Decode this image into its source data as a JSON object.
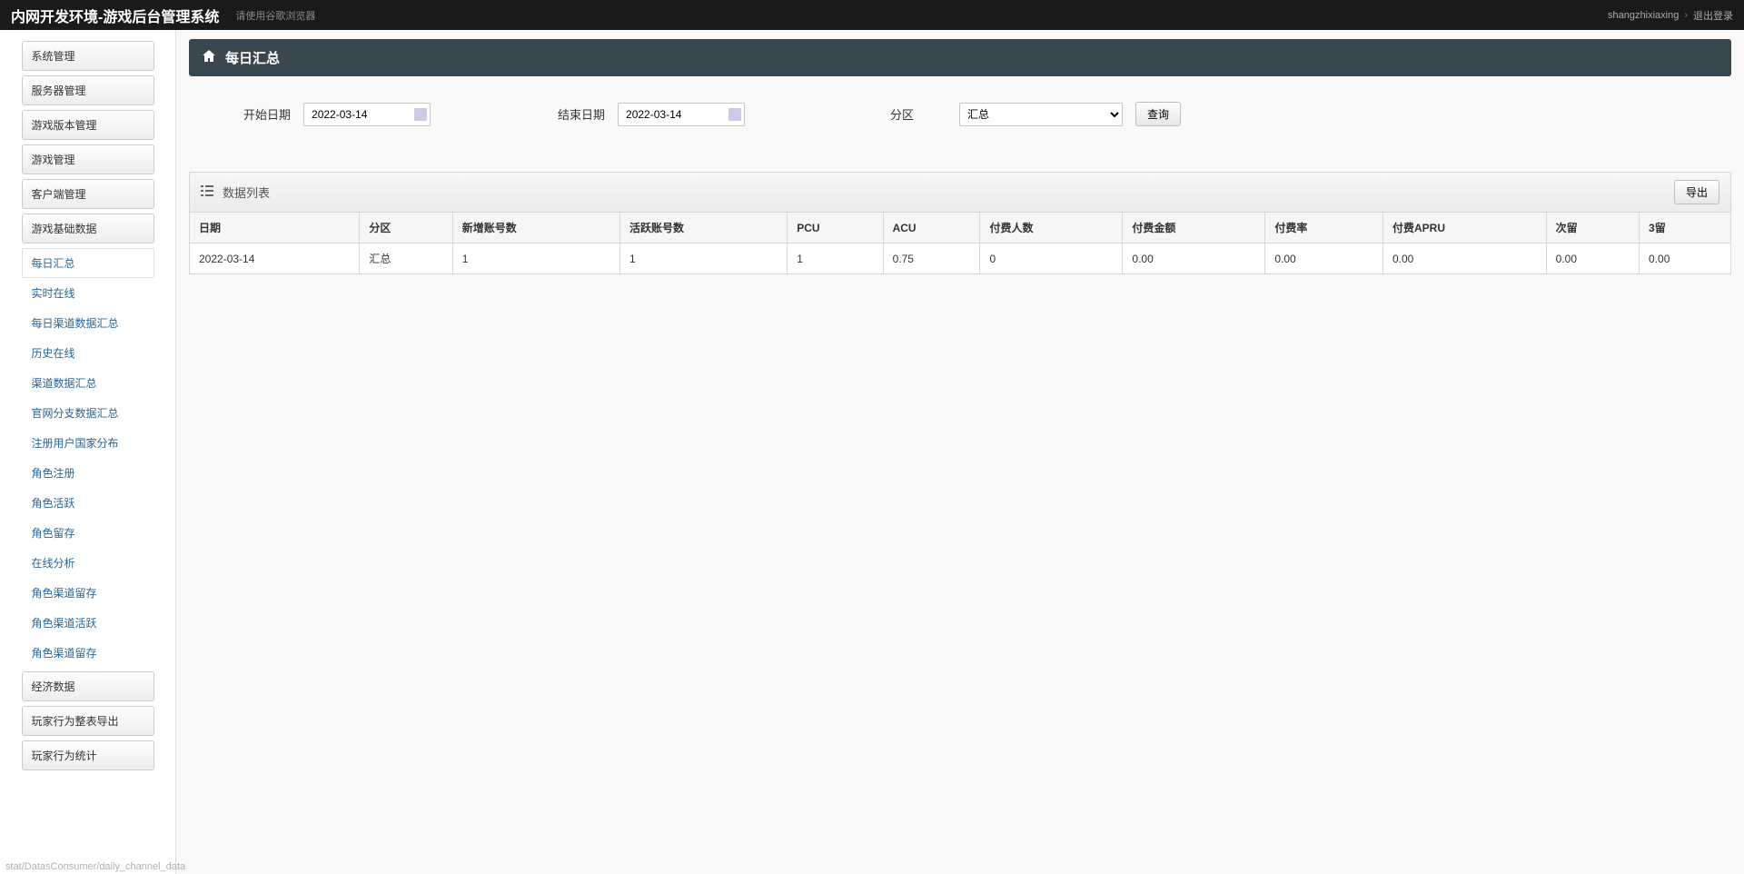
{
  "navbar": {
    "title": "内网开发环境-游戏后台管理系统",
    "tip": "请使用谷歌浏览器",
    "username": "shangzhixiaxing",
    "logout": "退出登录"
  },
  "sidebar": {
    "groups": [
      {
        "label": "系统管理",
        "items": []
      },
      {
        "label": "服务器管理",
        "items": []
      },
      {
        "label": "游戏版本管理",
        "items": []
      },
      {
        "label": "游戏管理",
        "items": []
      },
      {
        "label": "客户端管理",
        "items": []
      },
      {
        "label": "游戏基础数据",
        "items": [
          "每日汇总",
          "实时在线",
          "每日渠道数据汇总",
          "历史在线",
          "渠道数据汇总",
          "官网分支数据汇总",
          "注册用户国家分布",
          "角色注册",
          "角色活跃",
          "角色留存",
          "在线分析",
          "角色渠道留存",
          "角色渠道活跃",
          "角色渠道留存"
        ]
      },
      {
        "label": "经济数据",
        "items": []
      },
      {
        "label": "玩家行为整表导出",
        "items": []
      },
      {
        "label": "玩家行为统计",
        "items": []
      }
    ],
    "active_item": "每日汇总"
  },
  "page": {
    "title": "每日汇总"
  },
  "filters": {
    "start_label": "开始日期",
    "start_value": "2022-03-14",
    "end_label": "结束日期",
    "end_value": "2022-03-14",
    "zone_label": "分区",
    "zone_value": "汇总",
    "search": "查询"
  },
  "panel": {
    "title": "数据列表",
    "export": "导出"
  },
  "table": {
    "headers": [
      "日期",
      "分区",
      "新增账号数",
      "活跃账号数",
      "PCU",
      "ACU",
      "付费人数",
      "付费金额",
      "付费率",
      "付费APRU",
      "次留",
      "3留"
    ],
    "rows": [
      [
        "2022-03-14",
        "汇总",
        "1",
        "1",
        "1",
        "0.75",
        "0",
        "0.00",
        "0.00",
        "0.00",
        "0.00",
        "0.00"
      ]
    ]
  },
  "status": "stat/DatasConsumer/daily_channel_data"
}
